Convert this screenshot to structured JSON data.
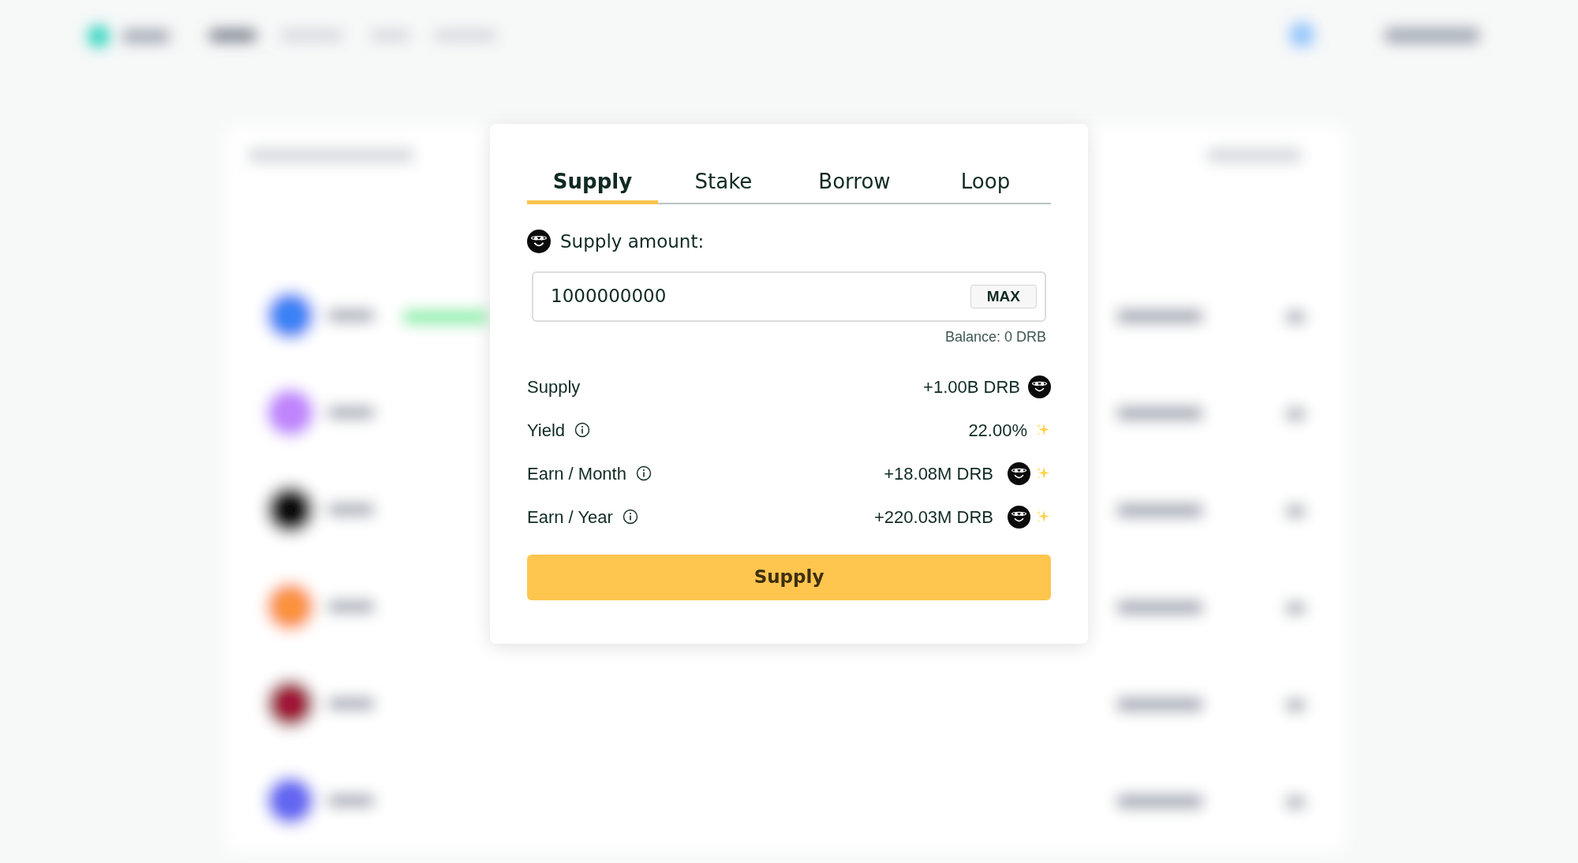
{
  "tabs": [
    {
      "label": "Supply",
      "selected": true
    },
    {
      "label": "Stake",
      "selected": false
    },
    {
      "label": "Borrow",
      "selected": false
    },
    {
      "label": "Loop",
      "selected": false
    }
  ],
  "amount": {
    "label": "Supply amount:",
    "value": "1000000000",
    "max_button": "MAX",
    "balance": "Balance: 0 DRB"
  },
  "summary": [
    {
      "label": "Supply",
      "info": false,
      "value": "+1.00B DRB",
      "token_icon": true,
      "sparkle": false
    },
    {
      "label": "Yield",
      "info": true,
      "value": "22.00%",
      "token_icon": false,
      "sparkle": true
    },
    {
      "label": "Earn / Month",
      "info": true,
      "value": "+18.08M DRB",
      "token_icon": true,
      "sparkle": true
    },
    {
      "label": "Earn / Year",
      "info": true,
      "value": "+220.03M DRB",
      "token_icon": true,
      "sparkle": true
    }
  ],
  "submit_button": "Supply"
}
